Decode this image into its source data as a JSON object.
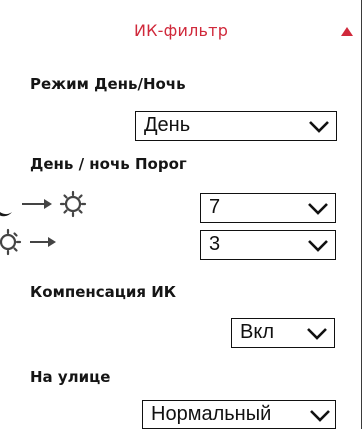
{
  "ir_filter": {
    "title": "ИК-фильтр",
    "collapse_icon": "triangle-up-icon",
    "accent_color": "#d0293b"
  },
  "day_night_mode": {
    "label": "Режим День/Ночь",
    "selected": "День"
  },
  "threshold": {
    "label": "День / ночь Порог",
    "night_to_day": {
      "icon": "moon-to-sun-icon",
      "selected": "7"
    },
    "day_to_night": {
      "icon": "sun-to-moon-icon",
      "selected": "3"
    }
  },
  "ir_compensation": {
    "label": "Компенсация ИК",
    "selected": "Вкл"
  },
  "outdoor": {
    "label": "На улице",
    "selected": "Нормальный"
  }
}
